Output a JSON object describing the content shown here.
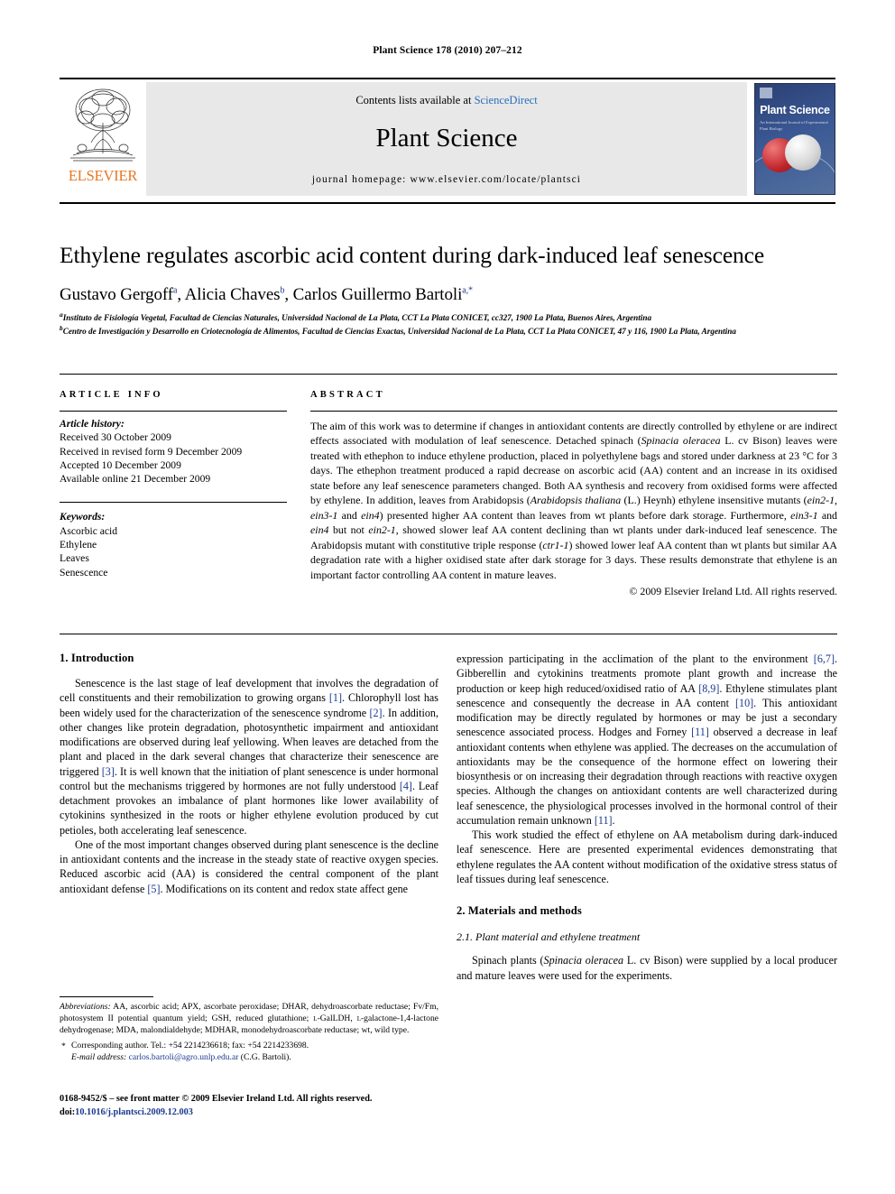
{
  "running_head": "Plant Science 178 (2010) 207–212",
  "masthead": {
    "contents_prefix": "Contents lists available at ",
    "sciencedirect": "ScienceDirect",
    "journal_name": "Plant Science",
    "homepage": "journal homepage: www.elsevier.com/locate/plantsci",
    "publisher_word": "ELSEVIER",
    "publisher_icon": "elsevier-tree-icon",
    "cover": {
      "title": "Plant Science",
      "subtitle": "An International Journal of Experimental Plant Biology"
    },
    "link_color": "#2a6ebb",
    "elsevier_orange": "#E87722"
  },
  "article": {
    "title": "Ethylene regulates ascorbic acid content during dark-induced leaf senescence",
    "authors": [
      {
        "name": "Gustavo Gergoff",
        "marks": "a"
      },
      {
        "name": "Alicia Chaves",
        "marks": "b"
      },
      {
        "name": "Carlos Guillermo Bartoli",
        "marks": "a,*"
      }
    ],
    "affiliations": [
      {
        "mark": "a",
        "text": "Instituto de Fisiología Vegetal, Facultad de Ciencias Naturales, Universidad Nacional de La Plata, CCT La Plata CONICET, cc327, 1900 La Plata, Buenos Aires, Argentina"
      },
      {
        "mark": "b",
        "text": "Centro de Investigación y Desarrollo en Criotecnología de Alimentos, Facultad de Ciencias Exactas, Universidad Nacional de La Plata, CCT La Plata CONICET, 47 y 116, 1900 La Plata, Argentina"
      }
    ]
  },
  "article_info": {
    "heading": "ARTICLE INFO",
    "history_label": "Article history:",
    "history": [
      "Received 30 October 2009",
      "Received in revised form 9 December 2009",
      "Accepted 10 December 2009",
      "Available online 21 December 2009"
    ],
    "keywords_label": "Keywords:",
    "keywords": [
      "Ascorbic acid",
      "Ethylene",
      "Leaves",
      "Senescence"
    ]
  },
  "abstract": {
    "heading": "ABSTRACT",
    "text_html": "The aim of this work was to determine if changes in antioxidant contents are directly controlled by ethylene or are indirect effects associated with modulation of leaf senescence. Detached spinach (<i>Spinacia oleracea</i> L. cv Bison) leaves were treated with ethephon to induce ethylene production, placed in polyethylene bags and stored under darkness at 23 °C for 3 days. The ethephon treatment produced a rapid decrease on ascorbic acid (AA) content and an increase in its oxidised state before any leaf senescence parameters changed. Both AA synthesis and recovery from oxidised forms were affected by ethylene. In addition, leaves from Arabidopsis (<i>Arabidopsis thaliana</i> (L.) Heynh) ethylene insensitive mutants (<i>ein2-1</i>, <i>ein3-1</i> and <i>ein4</i>) presented higher AA content than leaves from wt plants before dark storage. Furthermore, <i>ein3-1</i> and <i>ein4</i> but not <i>ein2-1</i>, showed slower leaf AA content declining than wt plants under dark-induced leaf senescence. The Arabidopsis mutant with constitutive triple response (<i>ctr1-1</i>) showed lower leaf AA content than wt plants but similar AA degradation rate with a higher oxidised state after dark storage for 3 days. These results demonstrate that ethylene is an important factor controlling AA content in mature leaves.",
    "copyright": "© 2009 Elsevier Ireland Ltd. All rights reserved."
  },
  "sections": {
    "introduction": {
      "heading": "1. Introduction",
      "paragraphs_html": [
        "Senescence is the last stage of leaf development that involves the degradation of cell constituents and their remobilization to growing organs <span class=\"ref\">[1]</span>. Chlorophyll lost has been widely used for the characterization of the senescence syndrome <span class=\"ref\">[2]</span>. In addition, other changes like protein degradation, photosynthetic impairment and antioxidant modifications are observed during leaf yellowing. When leaves are detached from the plant and placed in the dark several changes that characterize their senescence are triggered <span class=\"ref\">[3]</span>. It is well known that the initiation of plant senescence is under hormonal control but the mechanisms triggered by hormones are not fully understood <span class=\"ref\">[4]</span>. Leaf detachment provokes an imbalance of plant hormones like lower availability of cytokinins synthesized in the roots or higher ethylene evolution produced by cut petioles, both accelerating leaf senescence.",
        "One of the most important changes observed during plant senescence is the decline in antioxidant contents and the increase in the steady state of reactive oxygen species. Reduced ascorbic acid (AA) is considered the central component of the plant antioxidant defense <span class=\"ref\">[5]</span>. Modifications on its content and redox state affect gene expression participating in the acclimation of the plant to the environment <span class=\"ref\">[6,7]</span>. Gibberellin and cytokinins treatments promote plant growth and increase the production or keep high reduced/oxidised ratio of AA <span class=\"ref\">[8,9]</span>. Ethylene stimulates plant senescence and consequently the decrease in AA content <span class=\"ref\">[10]</span>. This antioxidant modification may be directly regulated by hormones or may be just a secondary senescence associated process. Hodges and Forney <span class=\"ref\">[11]</span> observed a decrease in leaf antioxidant contents when ethylene was applied. The decreases on the accumulation of antioxidants may be the consequence of the hormone effect on lowering their biosynthesis or on increasing their degradation through reactions with reactive oxygen species. Although the changes on antioxidant contents are well characterized during leaf senescence, the physiological processes involved in the hormonal control of their accumulation remain unknown <span class=\"ref\">[11]</span>.",
        "This work studied the effect of ethylene on AA metabolism during dark-induced leaf senescence. Here are presented experimental evidences demonstrating that ethylene regulates the AA content without modification of the oxidative stress status of leaf tissues during leaf senescence."
      ]
    },
    "materials": {
      "heading": "2. Materials and methods",
      "subheading": "2.1. Plant material and ethylene treatment",
      "paragraph_html": "Spinach plants (<i>Spinacia oleracea</i> L. cv Bison) were supplied by a local producer and mature leaves were used for the experiments."
    }
  },
  "footnotes": {
    "abbrev_label": "Abbreviations:",
    "abbrev_html": " AA, ascorbic acid; APX, ascorbate peroxidase; DHAR, dehydroascorbate reductase; Fv/Fm, photosystem II potential quantum yield; GSH, reduced glutathione; <span style=\"font-variant:small-caps\">l</span>-GalLDH, <span style=\"font-variant:small-caps\">l</span>-galactone-1,4-lactone dehydrogenase; MDA, malondialdehyde; MDHAR, monodehydroascorbate reductase; wt, wild type.",
    "corresponding": "Corresponding author. Tel.: +54 2214236618; fax: +54 2214233698.",
    "email_label": "E-mail address:",
    "email": "carlos.bartoli@agro.unlp.edu.ar",
    "email_suffix": " (C.G. Bartoli)."
  },
  "imprint": {
    "line1": "0168-9452/$ – see front matter © 2009 Elsevier Ireland Ltd. All rights reserved.",
    "doi_label": "doi:",
    "doi": "10.1016/j.plantsci.2009.12.003"
  }
}
